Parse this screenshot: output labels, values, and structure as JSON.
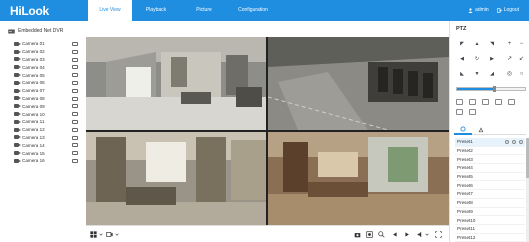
{
  "app": {
    "logo": "HiLook"
  },
  "nav": {
    "tabs": [
      {
        "label": "Live View",
        "active": true
      },
      {
        "label": "Playback",
        "active": false
      },
      {
        "label": "Picture",
        "active": false
      },
      {
        "label": "Configuration",
        "active": false
      }
    ],
    "user": {
      "name": "admin",
      "logout": "Logout"
    }
  },
  "sidebar": {
    "device": "Embedded Net DVR",
    "cameras": [
      "Camera 01",
      "Camera 02",
      "Camera 03",
      "Camera 04",
      "Camera 05",
      "Camera 06",
      "Camera 07",
      "Camera 08",
      "Camera 09",
      "Camera 10",
      "Camera 11",
      "Camera 12",
      "Camera 13",
      "Camera 14",
      "Camera 15",
      "Camera 16"
    ]
  },
  "ptz": {
    "title": "PTZ",
    "speed_level": 0.55,
    "presets": [
      "Preset1",
      "Preset2",
      "Preset3",
      "Preset4",
      "Preset5",
      "Preset6",
      "Preset7",
      "Preset8",
      "Preset9",
      "Preset10",
      "Preset11",
      "Preset12"
    ]
  },
  "colors": {
    "accent": "#1f8de0"
  }
}
